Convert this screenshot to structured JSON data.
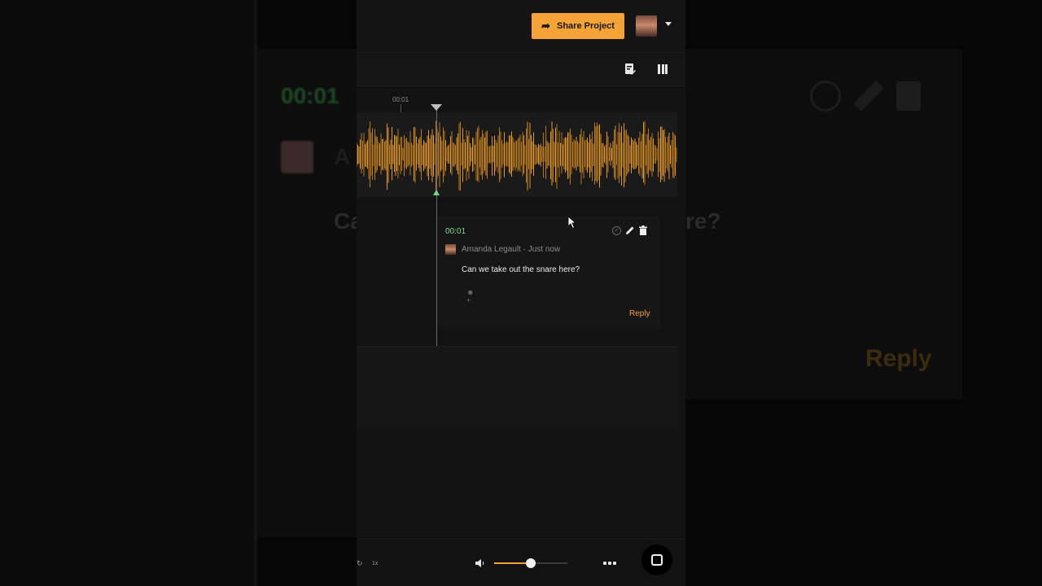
{
  "header": {
    "share_label": "Share Project"
  },
  "timeline": {
    "ruler_label": "00:01"
  },
  "comment": {
    "timestamp": "00:01",
    "author": "Amanda Legault",
    "separator": " · ",
    "time_ago": "Just now",
    "text": "Can we take out the snare here?",
    "reply_label": "Reply"
  },
  "player": {
    "speed_label": "1x",
    "volume_fraction": 0.5
  },
  "backdrop": {
    "time": "00:01",
    "letter_a": "A",
    "letter_c": "Ca",
    "text_end": "re?",
    "reply": "Reply"
  },
  "colors": {
    "accent": "#f5a236",
    "timestamp_green": "#7fd68b"
  },
  "icons": [
    "share-arrow-icon",
    "caret-down-icon",
    "note-edit-icon",
    "columns-icon",
    "resolve-check-icon",
    "pencil-icon",
    "trash-icon",
    "add-reaction-icon",
    "loop-icon",
    "volume-icon",
    "more-icon",
    "chat-icon",
    "cursor-icon"
  ]
}
